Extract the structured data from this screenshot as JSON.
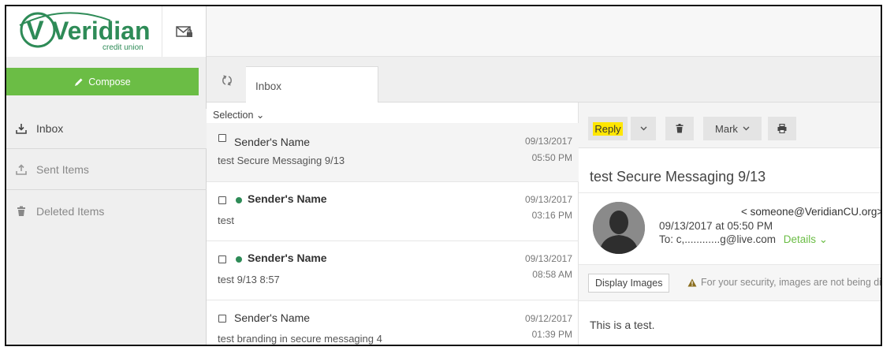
{
  "brand": {
    "name": "Veridian",
    "tagline": "credit union",
    "color": "#2e8b57"
  },
  "compose": {
    "label": "Compose"
  },
  "folders": [
    {
      "label": "Inbox",
      "icon": "download-tray-icon"
    },
    {
      "label": "Sent Items",
      "icon": "upload-tray-icon"
    },
    {
      "label": "Deleted Items",
      "icon": "trash-icon"
    }
  ],
  "tabs": [
    {
      "label": "Inbox"
    }
  ],
  "list": {
    "selection_label": "Selection ⌄",
    "messages": [
      {
        "sender": "Sender's Name",
        "subject": "test Secure Messaging 9/13",
        "date": "09/13/2017",
        "time": "05:50 PM",
        "unread": false,
        "selected": true
      },
      {
        "sender": "Sender's Name",
        "subject": "test",
        "date": "09/13/2017",
        "time": "03:16 PM",
        "unread": true,
        "selected": false
      },
      {
        "sender": "Sender's Name",
        "subject": "test 9/13 8:57",
        "date": "09/13/2017",
        "time": "08:58 AM",
        "unread": true,
        "selected": false
      },
      {
        "sender": "Sender's Name",
        "subject": "test branding in secure messaging 4",
        "date": "09/12/2017",
        "time": "01:39 PM",
        "unread": false,
        "selected": false
      }
    ]
  },
  "reading": {
    "toolbar": {
      "reply": "Reply",
      "mark": "Mark"
    },
    "subject": "test Secure Messaging 9/13",
    "from_email": "< someone@VeridianCU.org>",
    "date": "09/13/2017 at 05:50 PM",
    "to": "To: c,............g@live.com",
    "details": "Details ⌄",
    "display_images": "Display Images",
    "security_notice": "For your security, images are not being disp",
    "body": "This is a test."
  },
  "colors": {
    "accent": "#6bbd45",
    "highlight": "#ffe600",
    "unread_dot": "#2e8b57"
  }
}
